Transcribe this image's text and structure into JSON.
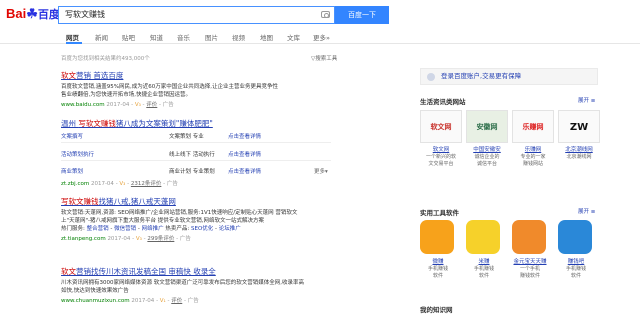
{
  "header": {
    "logo_bai": "Bai",
    "logo_paw": "☘",
    "logo_du": "百度",
    "query": "写软文赚钱",
    "search_button": "百度一下"
  },
  "tabs": [
    "网页",
    "新闻",
    "贴吧",
    "知道",
    "音乐",
    "图片",
    "视频",
    "地图",
    "文库",
    "更多»"
  ],
  "results_meta": {
    "count": "百度为您找到相关结果约493,000个",
    "tools": "▽搜索工具"
  },
  "results": [
    {
      "title_hl": "软文",
      "title_rest": "营销 首选百度",
      "desc1": "百度软文营销,涵盖95%网民,成为近60万家中国企业共同选择,让企业主营业务更具竞争性",
      "desc2": "售业绩翻倍,为您快速开拓市场,快捷企业营销因运营。",
      "url": "www.baidu.com",
      "date": "2017-04",
      "v": "V₃",
      "eval": "评价",
      "ad": "广告"
    },
    {
      "title_pre": "温州 ",
      "title_hl": "写软文赚钱",
      "title_rest": "猪八成为文案策划\"赚体肥肥\"",
      "sublinks": [
        [
          "文案撰写",
          "文案策划 专业",
          "点击查看详情"
        ],
        [
          "活动策划执行",
          "线上线下 活动执行",
          "点击查看详情"
        ],
        [
          "商业策划",
          "商业计划 专业策划",
          "点击查看详情"
        ]
      ],
      "more": "更多▾",
      "url": "zt.zbj.com",
      "date": "2017-04",
      "v": "V₃",
      "eval_count": "2312条评价",
      "ad": "广告"
    },
    {
      "title_hl": "写软文赚钱",
      "title_rest": "找猪八戒,猪八戒天蓬网",
      "desc1": "软文营销:天蓬网,资源: SEO网络推广/企业网站营销,服务:1V1快速响应/定制贴心天蓬网 营销软文",
      "desc2": "上\"天蓬网\"-猪八戒网旗下重大服务平台 提供专业软文营销,网络软文一站式解决方案",
      "hot_label": "热门服务:",
      "hot": [
        "整合营销",
        "微信营销",
        "网络推广"
      ],
      "hot2_label": "热卖产品:",
      "hot2": [
        "SEO优化",
        "论坛推广"
      ],
      "url": "zt.tianpeng.com",
      "date": "2017-04",
      "v": "V₃",
      "eval_count": "299条评价",
      "ad": "广告"
    },
    {
      "title_hl": "软文",
      "title_rest": "营销找传川木资讯发稿全国 审稿快 收录全",
      "desc1": "川木资讯网拥有3000家网络媒体资源 软文营销渠道广泛可靠发布后您的软文营销媒体全网,收录率高",
      "desc2": "如快,快达到快速效果效广告",
      "url": "www.chuanmuzixun.com",
      "date": "2017-04",
      "v": "V₁",
      "eval": "评价",
      "ad": "广告"
    }
  ],
  "right": {
    "login_text": "登录百度账户,交易更有保障",
    "section1_title": "生活资讯类网站",
    "section1_link": "展开 ≡",
    "sites": [
      {
        "img": "软文网",
        "name": "软文网",
        "d1": "一个新兴的软",
        "d2": "文交易平台"
      },
      {
        "img": "安徽网",
        "name": "中国安徽安",
        "d1": "诚信企业的",
        "d2": "诚信平台"
      },
      {
        "img": "乐赚网",
        "name": "乐赚网",
        "d1": "专业的一家",
        "d2": "赚钱网站"
      },
      {
        "img": "ZW",
        "name": "北京潮线网",
        "d1": "北京潮线网",
        "d2": ""
      }
    ],
    "section2_title": "实用工具软件",
    "section2_link": "展开 ≡",
    "softs": [
      {
        "name": "微赚",
        "d1": "手机赚钱",
        "d2": "软件",
        "color": "#f7a21b"
      },
      {
        "name": "米赚",
        "d1": "手机赚钱",
        "d2": "软件",
        "color": "#f6d12a"
      },
      {
        "name": "金元宝天天赚",
        "d1": "一个手机",
        "d2": "赚钱软件",
        "color": "#f08a2b"
      },
      {
        "name": "赚钱吧",
        "d1": "手机赚钱",
        "d2": "软件",
        "color": "#2a88d8"
      }
    ],
    "section3_title": "我的知识网"
  }
}
